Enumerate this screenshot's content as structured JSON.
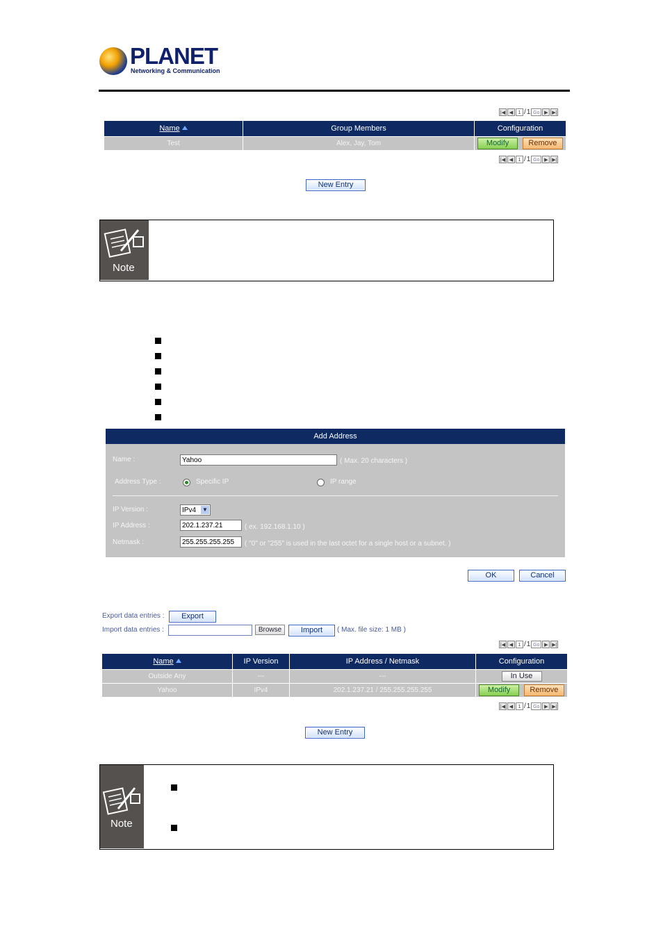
{
  "logo": {
    "brand": "PLANET",
    "tagline": "Networking & Communication"
  },
  "pager": {
    "page": "1",
    "separator": "/",
    "total": "1",
    "go": "Go"
  },
  "group_table": {
    "headers": {
      "name": "Name",
      "members": "Group Members",
      "config": "Configuration"
    },
    "row": {
      "name": "Test",
      "members": "Alex, Jay, Tom",
      "modify": "Modify",
      "remove": "Remove"
    }
  },
  "new_entry_label": "New Entry",
  "note_label": "Note",
  "add_address": {
    "title": "Add Address",
    "name_label": "Name :",
    "name_value": "Yahoo",
    "name_hint": "( Max. 20 characters )",
    "address_type_label": "Address Type :",
    "type_specific": "Specific IP",
    "type_range": "IP range",
    "ip_version_label": "IP Version :",
    "ip_version_value": "IPv4",
    "ip_address_label": "IP Address :",
    "ip_address_value": "202.1.237.21",
    "ip_address_hint": "( ex. 192.168.1.10 )",
    "netmask_label": "Netmask :",
    "netmask_value": "255.255.255.255",
    "netmask_hint": "( \"0\" or \"255\" is used in the last octet for a single host or a subnet. )"
  },
  "dialog": {
    "ok": "OK",
    "cancel": "Cancel"
  },
  "io": {
    "export_label": "Export data entries :",
    "export_button": "Export",
    "import_label": "Import data entries :",
    "browse_button": "Browse",
    "import_button": "Import",
    "import_hint": "( Max. file size: 1 MB )"
  },
  "address_table": {
    "headers": {
      "name": "Name",
      "version": "IP Version",
      "ip": "IP Address / Netmask",
      "config": "Configuration"
    },
    "rows": [
      {
        "name": "Outside Any",
        "version": "---",
        "ip": "---",
        "inuse": "In Use"
      },
      {
        "name": "Yahoo",
        "version": "IPv4",
        "ip": "202.1.237.21 / 255.255.255.255",
        "modify": "Modify",
        "remove": "Remove"
      }
    ]
  },
  "colors": {
    "header": "#0f2a63",
    "row": "#c4c4c4",
    "note_side": "#55514e"
  }
}
